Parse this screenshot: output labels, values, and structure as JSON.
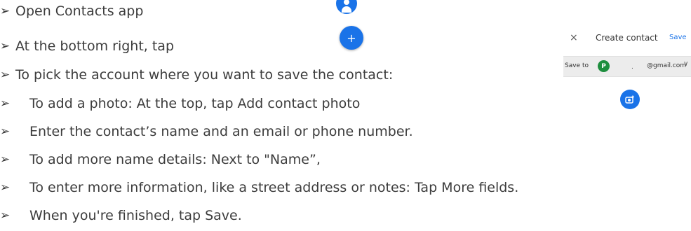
{
  "steps": [
    {
      "text": "Open Contacts app"
    },
    {
      "text": "At the bottom right, tap"
    },
    {
      "text": "To pick the account where you want to save the contact:"
    },
    {
      "text": "To add a photo: At the top, tap Add contact photo"
    },
    {
      "text": "Enter the contact’s name and an email or phone number."
    },
    {
      "text": "To add more name details: Next to \"Name”,"
    },
    {
      "text": "To enter more information, like a street address or notes: Tap More fields."
    },
    {
      "text": "When you're finished, tap Save."
    }
  ],
  "bullet_glyph": "➢",
  "icons": {
    "contacts": "contacts-app-icon",
    "fab": "add-contact-fab",
    "fab_glyph": "+"
  },
  "mini_screen": {
    "close_glyph": "×",
    "title": "Create contact",
    "save_label": "Save",
    "save_to_label": "Save to",
    "account_initial": "P",
    "account_dot": ".",
    "email": "@gmail.com",
    "chevron_glyph": "∨"
  },
  "colors": {
    "accent": "#1a73e8",
    "avatar": "#1e8e3e",
    "text": "#3c3c3c"
  }
}
